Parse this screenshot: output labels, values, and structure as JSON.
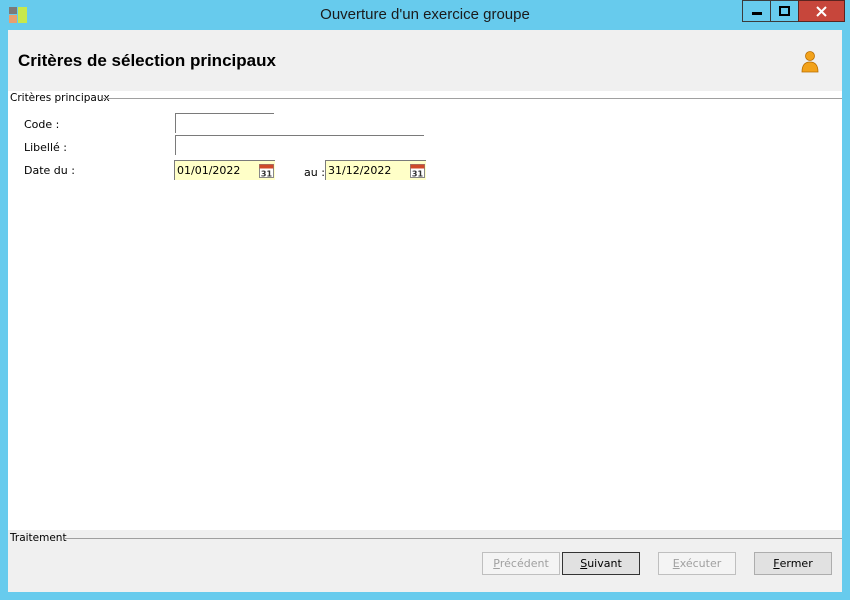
{
  "window": {
    "title": "Ouverture d'un exercice groupe"
  },
  "header": {
    "title": "Critères de sélection principaux",
    "icon": "user-icon"
  },
  "criteria_group": {
    "label": "Critères principaux",
    "code_label": "Code :",
    "code_value": "",
    "libelle_label": "Libellé :",
    "libelle_value": "",
    "date_from_label": "Date du :",
    "date_from_value": "01/01/2022",
    "date_to_label": "au :",
    "date_to_value": "31/12/2022",
    "calendar_day": "31"
  },
  "footer": {
    "group_label": "Traitement",
    "buttons": {
      "previous": {
        "first": "P",
        "rest": "récédent"
      },
      "next": {
        "first": "S",
        "rest": "uivant"
      },
      "execute": {
        "first": "E",
        "rest": "xécuter"
      },
      "close": {
        "first": "F",
        "rest": "ermer"
      }
    }
  },
  "colors": {
    "title_bar": "#67cbed",
    "close_button": "#c7463b",
    "date_field_bg": "#ffffc8"
  }
}
